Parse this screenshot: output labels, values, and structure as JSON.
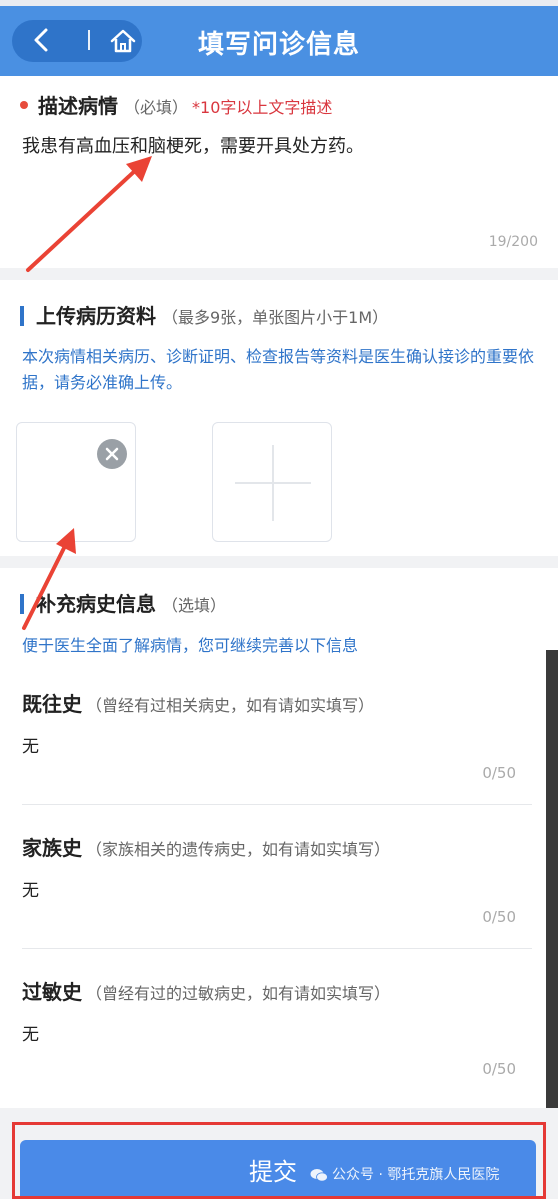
{
  "header": {
    "title": "填写问诊信息",
    "icons": [
      "back-icon",
      "home-icon"
    ],
    "bg_color": "#4a90e2"
  },
  "describe": {
    "title": "描述病情",
    "hint": "（必填）",
    "required_hint": "*10字以上文字描述",
    "text": "我患有高血压和脑梗死，需要开具处方药。",
    "count": "19/200"
  },
  "upload": {
    "title": "上传病历资料",
    "hint": "（最多9张，单张图片小于1M）",
    "desc": "本次病情相关病历、诊断证明、检查报告等资料是医生确认接诊的重要依据，请务必准确上传。",
    "icons": [
      "remove-icon",
      "plus-icon"
    ]
  },
  "history": {
    "title": "补充病史信息",
    "hint": "（选填）",
    "desc": "便于医生全面了解病情，您可继续完善以下信息",
    "items": [
      {
        "title": "既往史",
        "hint": "（曾经有过相关病史，如有请如实填写）",
        "value": "无",
        "count": "0/50"
      },
      {
        "title": "家族史",
        "hint": "（家族相关的遗传病史，如有请如实填写）",
        "value": "无",
        "count": "0/50"
      },
      {
        "title": "过敏史",
        "hint": "（曾经有过的过敏病史，如有请如实填写）",
        "value": "无",
        "count": "0/50"
      }
    ]
  },
  "submit": {
    "label": "提交",
    "accent_color": "#4a8ae8",
    "highlight_color": "#e53935"
  },
  "watermark": {
    "text": "公众号 · 鄂托克旗人民医院",
    "icon": "wechat-icon"
  }
}
